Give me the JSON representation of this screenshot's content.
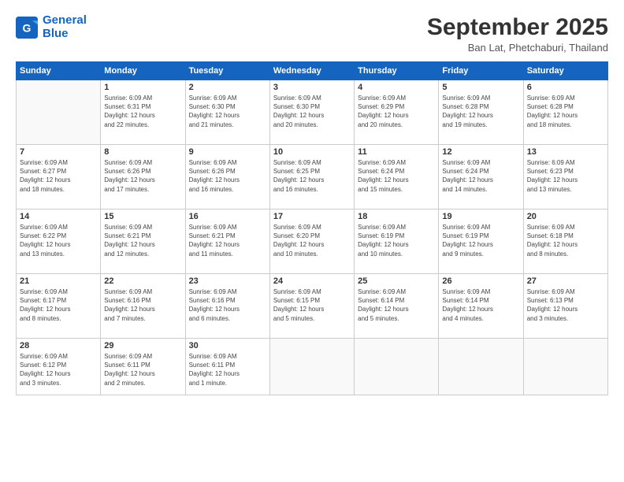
{
  "header": {
    "logo_line1": "General",
    "logo_line2": "Blue",
    "month_title": "September 2025",
    "location": "Ban Lat, Phetchaburi, Thailand"
  },
  "weekdays": [
    "Sunday",
    "Monday",
    "Tuesday",
    "Wednesday",
    "Thursday",
    "Friday",
    "Saturday"
  ],
  "weeks": [
    [
      {
        "day": "",
        "info": ""
      },
      {
        "day": "1",
        "info": "Sunrise: 6:09 AM\nSunset: 6:31 PM\nDaylight: 12 hours\nand 22 minutes."
      },
      {
        "day": "2",
        "info": "Sunrise: 6:09 AM\nSunset: 6:30 PM\nDaylight: 12 hours\nand 21 minutes."
      },
      {
        "day": "3",
        "info": "Sunrise: 6:09 AM\nSunset: 6:30 PM\nDaylight: 12 hours\nand 20 minutes."
      },
      {
        "day": "4",
        "info": "Sunrise: 6:09 AM\nSunset: 6:29 PM\nDaylight: 12 hours\nand 20 minutes."
      },
      {
        "day": "5",
        "info": "Sunrise: 6:09 AM\nSunset: 6:28 PM\nDaylight: 12 hours\nand 19 minutes."
      },
      {
        "day": "6",
        "info": "Sunrise: 6:09 AM\nSunset: 6:28 PM\nDaylight: 12 hours\nand 18 minutes."
      }
    ],
    [
      {
        "day": "7",
        "info": "Sunrise: 6:09 AM\nSunset: 6:27 PM\nDaylight: 12 hours\nand 18 minutes."
      },
      {
        "day": "8",
        "info": "Sunrise: 6:09 AM\nSunset: 6:26 PM\nDaylight: 12 hours\nand 17 minutes."
      },
      {
        "day": "9",
        "info": "Sunrise: 6:09 AM\nSunset: 6:26 PM\nDaylight: 12 hours\nand 16 minutes."
      },
      {
        "day": "10",
        "info": "Sunrise: 6:09 AM\nSunset: 6:25 PM\nDaylight: 12 hours\nand 16 minutes."
      },
      {
        "day": "11",
        "info": "Sunrise: 6:09 AM\nSunset: 6:24 PM\nDaylight: 12 hours\nand 15 minutes."
      },
      {
        "day": "12",
        "info": "Sunrise: 6:09 AM\nSunset: 6:24 PM\nDaylight: 12 hours\nand 14 minutes."
      },
      {
        "day": "13",
        "info": "Sunrise: 6:09 AM\nSunset: 6:23 PM\nDaylight: 12 hours\nand 13 minutes."
      }
    ],
    [
      {
        "day": "14",
        "info": "Sunrise: 6:09 AM\nSunset: 6:22 PM\nDaylight: 12 hours\nand 13 minutes."
      },
      {
        "day": "15",
        "info": "Sunrise: 6:09 AM\nSunset: 6:21 PM\nDaylight: 12 hours\nand 12 minutes."
      },
      {
        "day": "16",
        "info": "Sunrise: 6:09 AM\nSunset: 6:21 PM\nDaylight: 12 hours\nand 11 minutes."
      },
      {
        "day": "17",
        "info": "Sunrise: 6:09 AM\nSunset: 6:20 PM\nDaylight: 12 hours\nand 10 minutes."
      },
      {
        "day": "18",
        "info": "Sunrise: 6:09 AM\nSunset: 6:19 PM\nDaylight: 12 hours\nand 10 minutes."
      },
      {
        "day": "19",
        "info": "Sunrise: 6:09 AM\nSunset: 6:19 PM\nDaylight: 12 hours\nand 9 minutes."
      },
      {
        "day": "20",
        "info": "Sunrise: 6:09 AM\nSunset: 6:18 PM\nDaylight: 12 hours\nand 8 minutes."
      }
    ],
    [
      {
        "day": "21",
        "info": "Sunrise: 6:09 AM\nSunset: 6:17 PM\nDaylight: 12 hours\nand 8 minutes."
      },
      {
        "day": "22",
        "info": "Sunrise: 6:09 AM\nSunset: 6:16 PM\nDaylight: 12 hours\nand 7 minutes."
      },
      {
        "day": "23",
        "info": "Sunrise: 6:09 AM\nSunset: 6:16 PM\nDaylight: 12 hours\nand 6 minutes."
      },
      {
        "day": "24",
        "info": "Sunrise: 6:09 AM\nSunset: 6:15 PM\nDaylight: 12 hours\nand 5 minutes."
      },
      {
        "day": "25",
        "info": "Sunrise: 6:09 AM\nSunset: 6:14 PM\nDaylight: 12 hours\nand 5 minutes."
      },
      {
        "day": "26",
        "info": "Sunrise: 6:09 AM\nSunset: 6:14 PM\nDaylight: 12 hours\nand 4 minutes."
      },
      {
        "day": "27",
        "info": "Sunrise: 6:09 AM\nSunset: 6:13 PM\nDaylight: 12 hours\nand 3 minutes."
      }
    ],
    [
      {
        "day": "28",
        "info": "Sunrise: 6:09 AM\nSunset: 6:12 PM\nDaylight: 12 hours\nand 3 minutes."
      },
      {
        "day": "29",
        "info": "Sunrise: 6:09 AM\nSunset: 6:11 PM\nDaylight: 12 hours\nand 2 minutes."
      },
      {
        "day": "30",
        "info": "Sunrise: 6:09 AM\nSunset: 6:11 PM\nDaylight: 12 hours\nand 1 minute."
      },
      {
        "day": "",
        "info": ""
      },
      {
        "day": "",
        "info": ""
      },
      {
        "day": "",
        "info": ""
      },
      {
        "day": "",
        "info": ""
      }
    ]
  ]
}
